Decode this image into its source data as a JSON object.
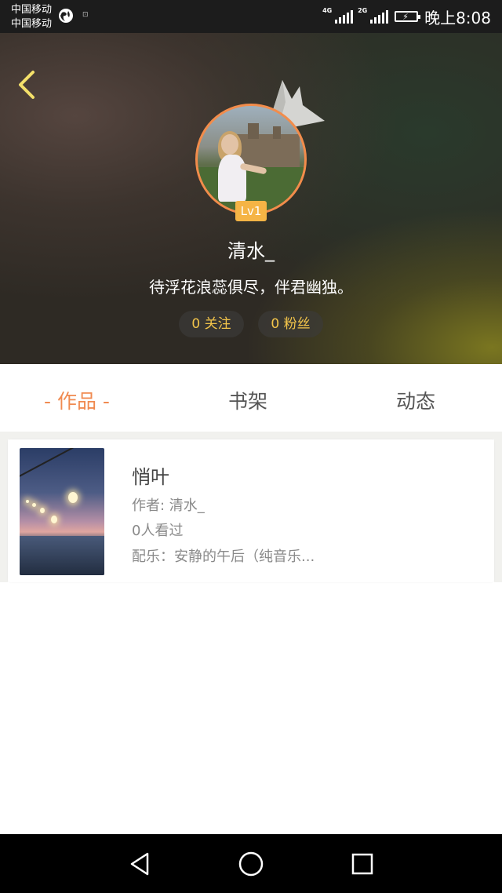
{
  "status_bar": {
    "carrier_1": "中国移动",
    "carrier_2": "中国移动",
    "network_1": "4G",
    "network_2": "2G",
    "time": "晚上8:08"
  },
  "profile": {
    "level": "Lv1",
    "username": "清水_",
    "bio": "待浮花浪蕊俱尽，伴君幽独。",
    "following_label": "0 关注",
    "fans_label": "0 粉丝",
    "accent_color": "#f28c4b"
  },
  "tabs": [
    {
      "label": "- 作品 -",
      "active": true
    },
    {
      "label": "书架",
      "active": false
    },
    {
      "label": "动态",
      "active": false
    }
  ],
  "works": [
    {
      "title": "悄叶",
      "author": "作者: 清水_",
      "views": "0人看过",
      "music": "配乐：安静的午后（纯音乐..."
    }
  ],
  "icons": {
    "back": "back-chevron-icon",
    "crown": "crown-icon",
    "nav_back": "triangle-back-icon",
    "nav_home": "circle-home-icon",
    "nav_recent": "square-recent-icon"
  }
}
